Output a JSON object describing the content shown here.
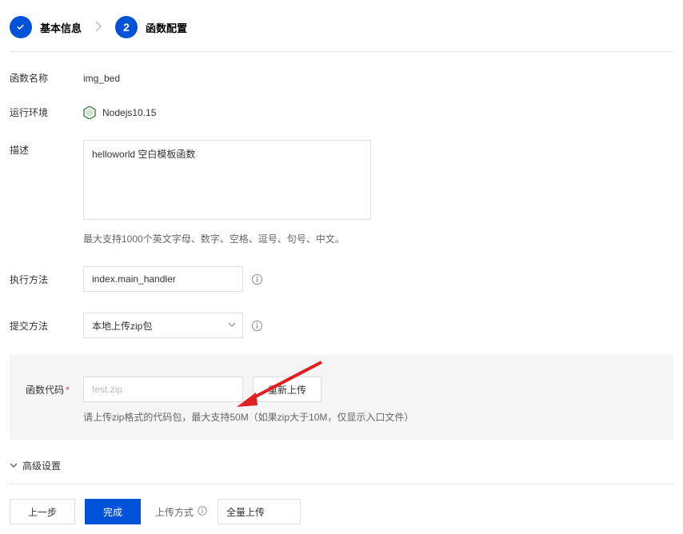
{
  "steps": {
    "step1": "基本信息",
    "step2_num": "2",
    "step2": "函数配置"
  },
  "labels": {
    "fn_name": "函数名称",
    "runtime": "运行环境",
    "description": "描述",
    "execute": "执行方法",
    "submit": "提交方法",
    "code": "函数代码",
    "adv": "高级设置",
    "upload_mode": "上传方式"
  },
  "values": {
    "fn_name": "img_bed",
    "runtime": "Nodejs10.15",
    "description": "helloworld 空白模板函数",
    "desc_hint": "最大支持1000个英文字母、数字、空格、逗号、句号、中文。",
    "execute": "index.main_handler",
    "submit": "本地上传zip包",
    "file_placeholder": "test.zip",
    "reupload": "重新上传",
    "code_hint": "请上传zip格式的代码包，最大支持50M（如果zip大于10M，仅显示入口文件）",
    "upload_mode": "全量上传"
  },
  "footer": {
    "prev": "上一步",
    "done": "完成"
  }
}
